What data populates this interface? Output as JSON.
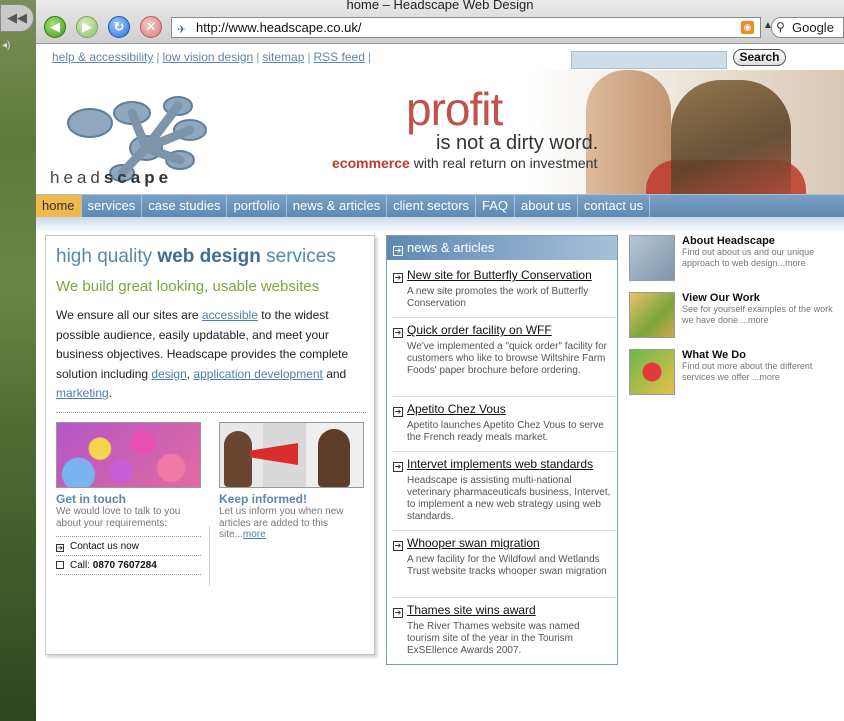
{
  "window": {
    "title": "home – Headscape Web Design"
  },
  "toolbar": {
    "url": "http://www.headscape.co.uk/",
    "search_engine": "Google",
    "icons": [
      "back-icon",
      "forward-icon",
      "reload-icon",
      "stop-icon",
      "rss-icon",
      "search-icon"
    ]
  },
  "utility_links": [
    "help & accessibility",
    "low vision design",
    "sitemap",
    "RSS feed"
  ],
  "site_search": {
    "button_label": "Search",
    "value": ""
  },
  "logo": {
    "word_light": "head",
    "word_bold": "scape"
  },
  "banner": {
    "line1": "profit",
    "line2": "is not a dirty word.",
    "line3_accent": "ecommerce",
    "line3_rest": "with real return on investment"
  },
  "nav": [
    "home",
    "services",
    "case studies",
    "portfolio",
    "news & articles",
    "client sectors",
    "FAQ",
    "about us",
    "contact us"
  ],
  "main": {
    "heading_plain_before": "high quality ",
    "heading_bold": "web design",
    "heading_plain_after": " services",
    "subheading": "We build great looking, usable websites",
    "intro": {
      "p1": "We ensure all our sites are ",
      "link_accessible": "accessible",
      "p2": " to the widest possible audience, easily updatable, and meet your business objectives. Headscape provides the complete solution including ",
      "link_design": "design",
      "sep1": ", ",
      "link_appdev": "application development",
      "p3": " and ",
      "link_marketing": "marketing",
      "p4": "."
    },
    "touch": {
      "title": "Get in touch",
      "text": "We would love to talk to you about your requirements:",
      "contact_label": "Contact us now",
      "call_label": "Call: ",
      "phone": "0870 7607284"
    },
    "informed": {
      "title": "Keep informed!",
      "text": "Let us inform you when new articles are added to this site...",
      "more": "more"
    }
  },
  "news": {
    "heading": "news & articles",
    "items": [
      {
        "title": "New site for Butterfly Conservation",
        "desc": "A new site promotes the work of Butterfly Conservation"
      },
      {
        "title": "Quick order facility on WFF",
        "desc": "We've implemented a \"quick order\" facility for customers who like to browse Wiltshire Farm Foods' paper brochure before ordering."
      },
      {
        "title": "Apetito Chez Vous",
        "desc": "Apetito launches Apetito Chez Vous to serve the French ready meals market."
      },
      {
        "title": "Intervet implements web standards",
        "desc": "Headscape is assisting multi-national veterinary pharmaceuticals business, Intervet, to implement a new web strategy using web standards."
      },
      {
        "title": "Whooper swan migration",
        "desc": "A new facility for the Wildfowl and Wetlands Trust website tracks whooper swan migration"
      },
      {
        "title": "Thames site wins award",
        "desc": "The River Thames website was named tourism site of the year in the Tourism ExSEllence Awards 2007."
      }
    ]
  },
  "side": [
    {
      "title": "About Headscape",
      "text": "Find out about us and our unique approach to web design...",
      "more": "more"
    },
    {
      "title": "View Our Work",
      "text": "See for yourself examples of the work we have done ...",
      "more": "more"
    },
    {
      "title": "What We Do",
      "text": "Find out more about the different services we offer ...",
      "more": "more"
    }
  ]
}
